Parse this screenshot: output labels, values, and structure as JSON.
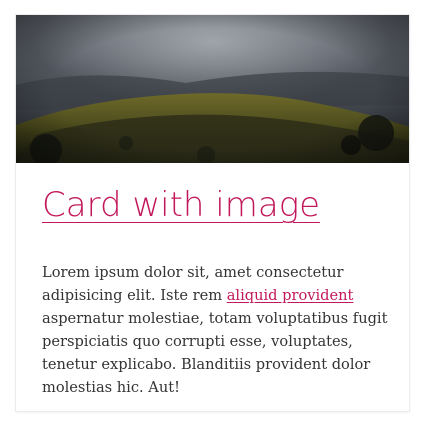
{
  "card": {
    "title": "Card with image",
    "body_before_link": "Lorem ipsum dolor sit, amet consectetur adipisicing elit. Iste rem ",
    "body_link": "aliquid provident",
    "body_after_link": " aspernatur molestiae, totam voluptatibus fugit perspiciatis quo corrupti esse, voluptates, tenetur explicabo. Blanditiis provident dolor molestias hic. Aut!"
  },
  "colors": {
    "accent": "#c2185b",
    "text": "#333333",
    "card_background": "#ffffff"
  }
}
